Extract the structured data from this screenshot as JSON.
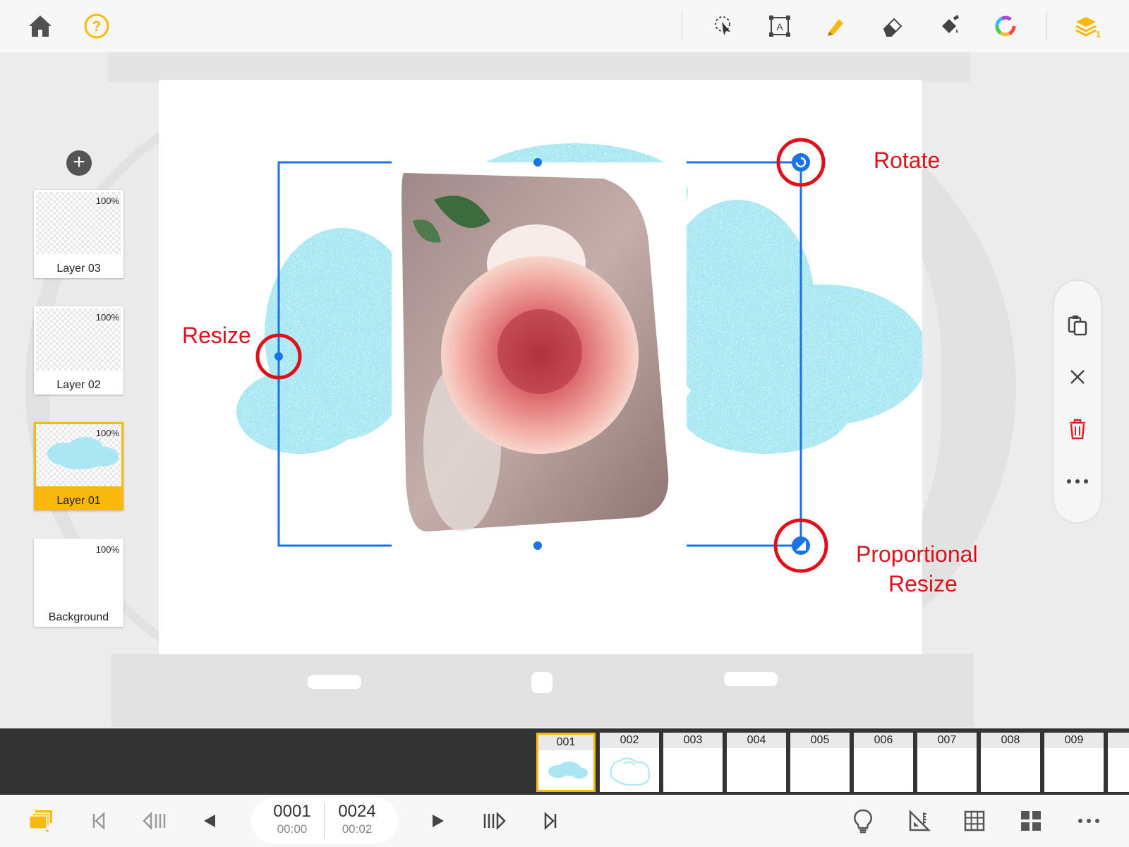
{
  "toolbar": {
    "left": [
      {
        "icon": "home-icon"
      },
      {
        "icon": "help-icon"
      }
    ],
    "tools": [
      {
        "icon": "lasso-select-icon"
      },
      {
        "icon": "text-tool-icon"
      },
      {
        "icon": "pen-icon"
      },
      {
        "icon": "eraser-icon"
      },
      {
        "icon": "fill-bucket-icon"
      },
      {
        "icon": "color-wheel-icon"
      }
    ],
    "layers_button": {
      "icon": "layers-icon",
      "count": "1"
    },
    "accent": "#f9b80b"
  },
  "layers": [
    {
      "name": "Layer 03",
      "opacity": "100%",
      "selected": false
    },
    {
      "name": "Layer 02",
      "opacity": "100%",
      "selected": false
    },
    {
      "name": "Layer 01",
      "opacity": "100%",
      "selected": true
    },
    {
      "name": "Background",
      "opacity": "100%",
      "selected": false
    }
  ],
  "annotations": {
    "rotate": "Rotate",
    "resize": "Resize",
    "proportional_resize_line1": "Proportional",
    "proportional_resize_line2": "Resize",
    "color": "#e0101b"
  },
  "selection": {
    "color": "#1a73e8"
  },
  "right_panel": [
    {
      "icon": "paste-icon"
    },
    {
      "icon": "close-icon"
    },
    {
      "icon": "trash-icon"
    },
    {
      "icon": "more-icon"
    }
  ],
  "timeline": {
    "frames": [
      "001",
      "002",
      "003",
      "004",
      "005",
      "006",
      "007",
      "008",
      "009"
    ],
    "selected_frame": "001"
  },
  "playback": {
    "current_frame": "0001",
    "current_time": "00:00",
    "total_frames": "0024",
    "total_time": "00:02"
  },
  "bottom_tools": [
    {
      "icon": "frames-stack-icon"
    },
    {
      "icon": "first-frame-icon"
    },
    {
      "icon": "prev-frame-icon"
    },
    {
      "icon": "play-reverse-icon"
    },
    {
      "icon": "play-icon"
    },
    {
      "icon": "next-frame-icon"
    },
    {
      "icon": "last-frame-icon"
    },
    {
      "icon": "lightbulb-icon"
    },
    {
      "icon": "ruler-icon"
    },
    {
      "icon": "grid-icon"
    },
    {
      "icon": "tiles-icon"
    },
    {
      "icon": "more-icon"
    }
  ]
}
